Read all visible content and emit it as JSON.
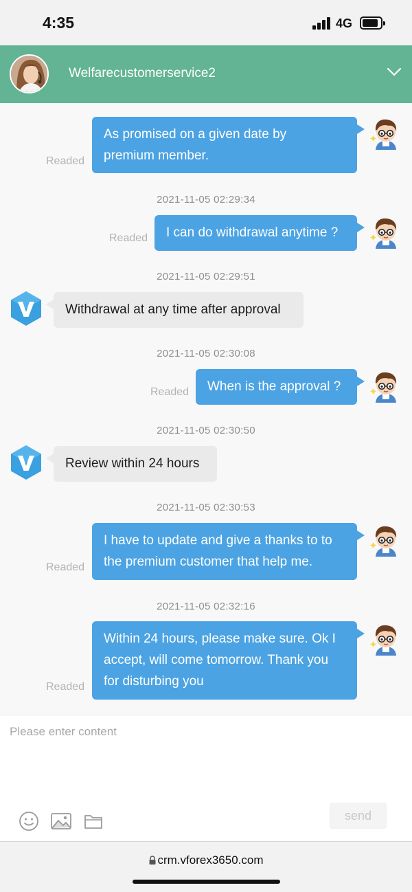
{
  "status_bar": {
    "time": "4:35",
    "network": "4G"
  },
  "header": {
    "agent_name": "Welfarecustomerservice2",
    "collapse_icon": "chevron-down-icon"
  },
  "messages": [
    {
      "direction": "out",
      "lines": [
        "As promised on a given date by",
        "premium member."
      ],
      "status": "Readed"
    },
    {
      "timestamp": "2021-11-05 02:29:34"
    },
    {
      "direction": "out",
      "lines": [
        "I can do withdrawal anytime ?"
      ],
      "status": "Readed"
    },
    {
      "timestamp": "2021-11-05 02:29:51"
    },
    {
      "direction": "in",
      "lines": [
        "Withdrawal at any time after approval"
      ]
    },
    {
      "timestamp": "2021-11-05 02:30:08"
    },
    {
      "direction": "out",
      "lines": [
        "When is the approval ?"
      ],
      "status": "Readed"
    },
    {
      "timestamp": "2021-11-05 02:30:50"
    },
    {
      "direction": "in",
      "lines": [
        "Review within 24 hours"
      ]
    },
    {
      "timestamp": "2021-11-05 02:30:53"
    },
    {
      "direction": "out",
      "lines": [
        "I have to update and give a thanks to to",
        "the premium customer that help me."
      ],
      "status": "Readed"
    },
    {
      "timestamp": "2021-11-05 02:32:16"
    },
    {
      "direction": "out",
      "lines": [
        "Within 24 hours, please make sure. Ok I",
        "accept, will come tomorrow. Thank you",
        "for disturbing you"
      ],
      "status": "Readed"
    }
  ],
  "composer": {
    "placeholder": "Please enter content",
    "send_label": "send",
    "tools": [
      "emoji-icon",
      "image-icon",
      "folder-icon"
    ]
  },
  "browser": {
    "url": "crm.vforex3650.com"
  },
  "colors": {
    "header_green": "#63b494",
    "bubble_blue": "#4ba3e3",
    "bubble_gray": "#eaeaea"
  }
}
